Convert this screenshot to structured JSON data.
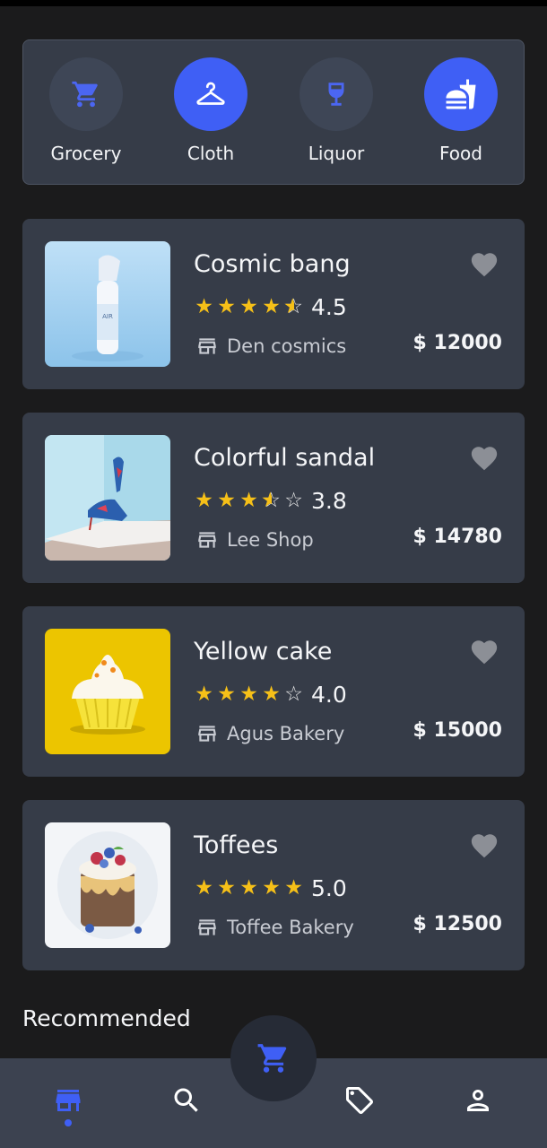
{
  "categories": [
    {
      "label": "Grocery",
      "icon": "cart-icon",
      "active": false
    },
    {
      "label": "Cloth",
      "icon": "hanger-icon",
      "active": true
    },
    {
      "label": "Liquor",
      "icon": "wine-glass-icon",
      "active": false
    },
    {
      "label": "Food",
      "icon": "fastfood-icon",
      "active": true
    }
  ],
  "products": [
    {
      "title": "Cosmic bang",
      "rating": "4.5",
      "stars": 4.5,
      "shop": "Den cosmics",
      "price": "$ 12000",
      "image": "air-freshener-image"
    },
    {
      "title": "Colorful sandal",
      "rating": "3.8",
      "stars": 3.8,
      "shop": "Lee Shop",
      "price": "$ 14780",
      "image": "high-heel-image"
    },
    {
      "title": "Yellow cake",
      "rating": "4.0",
      "stars": 4.0,
      "shop": "Agus Bakery",
      "price": "$ 15000",
      "image": "cupcake-image"
    },
    {
      "title": "Toffees",
      "rating": "5.0",
      "stars": 5.0,
      "shop": "Toffee Bakery",
      "price": "$ 12500",
      "image": "toffee-cake-image"
    }
  ],
  "section": {
    "recommended": "Recommended"
  },
  "nav": {
    "items": [
      "store-icon",
      "search-icon",
      "tag-icon",
      "profile-icon"
    ],
    "fab": "cart-icon"
  },
  "colors": {
    "accent": "#3f5ff5",
    "star": "#f6c018",
    "card": "#363c48",
    "background": "#1b1b1c"
  }
}
